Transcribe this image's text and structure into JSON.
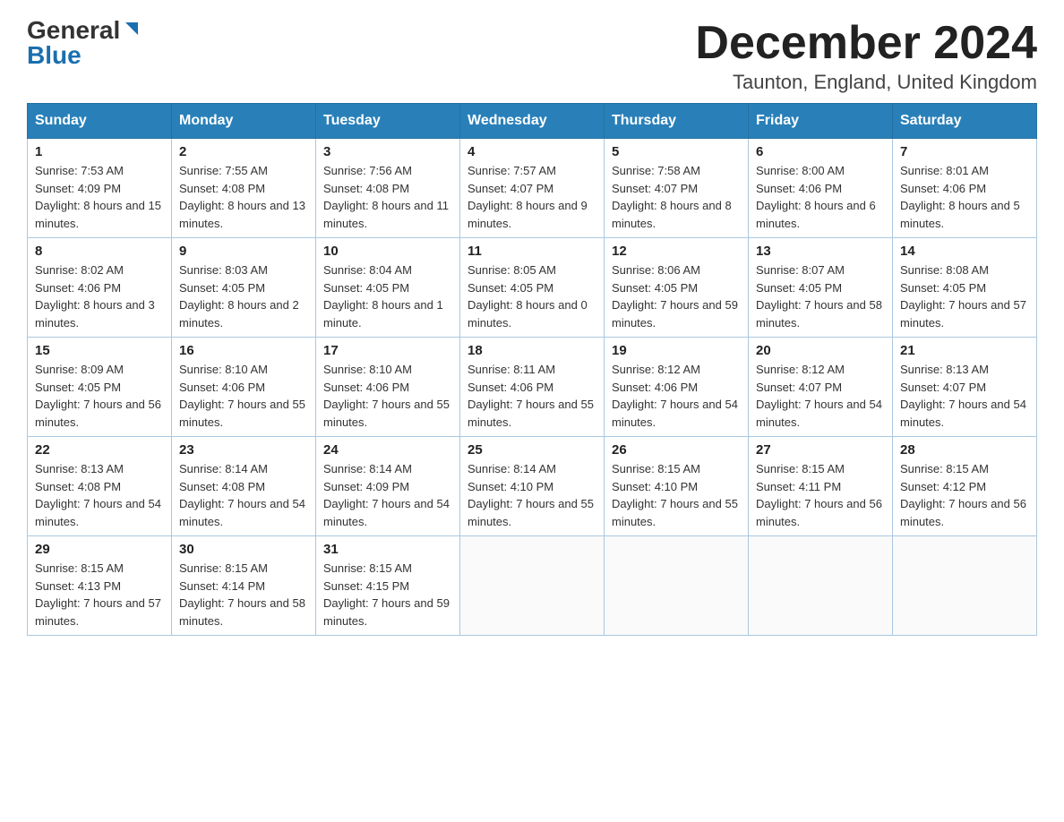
{
  "header": {
    "logo_general": "General",
    "logo_blue": "Blue",
    "month_title": "December 2024",
    "location": "Taunton, England, United Kingdom"
  },
  "columns": [
    "Sunday",
    "Monday",
    "Tuesday",
    "Wednesday",
    "Thursday",
    "Friday",
    "Saturday"
  ],
  "weeks": [
    [
      {
        "day": "1",
        "sunrise": "7:53 AM",
        "sunset": "4:09 PM",
        "daylight": "8 hours and 15 minutes."
      },
      {
        "day": "2",
        "sunrise": "7:55 AM",
        "sunset": "4:08 PM",
        "daylight": "8 hours and 13 minutes."
      },
      {
        "day": "3",
        "sunrise": "7:56 AM",
        "sunset": "4:08 PM",
        "daylight": "8 hours and 11 minutes."
      },
      {
        "day": "4",
        "sunrise": "7:57 AM",
        "sunset": "4:07 PM",
        "daylight": "8 hours and 9 minutes."
      },
      {
        "day": "5",
        "sunrise": "7:58 AM",
        "sunset": "4:07 PM",
        "daylight": "8 hours and 8 minutes."
      },
      {
        "day": "6",
        "sunrise": "8:00 AM",
        "sunset": "4:06 PM",
        "daylight": "8 hours and 6 minutes."
      },
      {
        "day": "7",
        "sunrise": "8:01 AM",
        "sunset": "4:06 PM",
        "daylight": "8 hours and 5 minutes."
      }
    ],
    [
      {
        "day": "8",
        "sunrise": "8:02 AM",
        "sunset": "4:06 PM",
        "daylight": "8 hours and 3 minutes."
      },
      {
        "day": "9",
        "sunrise": "8:03 AM",
        "sunset": "4:05 PM",
        "daylight": "8 hours and 2 minutes."
      },
      {
        "day": "10",
        "sunrise": "8:04 AM",
        "sunset": "4:05 PM",
        "daylight": "8 hours and 1 minute."
      },
      {
        "day": "11",
        "sunrise": "8:05 AM",
        "sunset": "4:05 PM",
        "daylight": "8 hours and 0 minutes."
      },
      {
        "day": "12",
        "sunrise": "8:06 AM",
        "sunset": "4:05 PM",
        "daylight": "7 hours and 59 minutes."
      },
      {
        "day": "13",
        "sunrise": "8:07 AM",
        "sunset": "4:05 PM",
        "daylight": "7 hours and 58 minutes."
      },
      {
        "day": "14",
        "sunrise": "8:08 AM",
        "sunset": "4:05 PM",
        "daylight": "7 hours and 57 minutes."
      }
    ],
    [
      {
        "day": "15",
        "sunrise": "8:09 AM",
        "sunset": "4:05 PM",
        "daylight": "7 hours and 56 minutes."
      },
      {
        "day": "16",
        "sunrise": "8:10 AM",
        "sunset": "4:06 PM",
        "daylight": "7 hours and 55 minutes."
      },
      {
        "day": "17",
        "sunrise": "8:10 AM",
        "sunset": "4:06 PM",
        "daylight": "7 hours and 55 minutes."
      },
      {
        "day": "18",
        "sunrise": "8:11 AM",
        "sunset": "4:06 PM",
        "daylight": "7 hours and 55 minutes."
      },
      {
        "day": "19",
        "sunrise": "8:12 AM",
        "sunset": "4:06 PM",
        "daylight": "7 hours and 54 minutes."
      },
      {
        "day": "20",
        "sunrise": "8:12 AM",
        "sunset": "4:07 PM",
        "daylight": "7 hours and 54 minutes."
      },
      {
        "day": "21",
        "sunrise": "8:13 AM",
        "sunset": "4:07 PM",
        "daylight": "7 hours and 54 minutes."
      }
    ],
    [
      {
        "day": "22",
        "sunrise": "8:13 AM",
        "sunset": "4:08 PM",
        "daylight": "7 hours and 54 minutes."
      },
      {
        "day": "23",
        "sunrise": "8:14 AM",
        "sunset": "4:08 PM",
        "daylight": "7 hours and 54 minutes."
      },
      {
        "day": "24",
        "sunrise": "8:14 AM",
        "sunset": "4:09 PM",
        "daylight": "7 hours and 54 minutes."
      },
      {
        "day": "25",
        "sunrise": "8:14 AM",
        "sunset": "4:10 PM",
        "daylight": "7 hours and 55 minutes."
      },
      {
        "day": "26",
        "sunrise": "8:15 AM",
        "sunset": "4:10 PM",
        "daylight": "7 hours and 55 minutes."
      },
      {
        "day": "27",
        "sunrise": "8:15 AM",
        "sunset": "4:11 PM",
        "daylight": "7 hours and 56 minutes."
      },
      {
        "day": "28",
        "sunrise": "8:15 AM",
        "sunset": "4:12 PM",
        "daylight": "7 hours and 56 minutes."
      }
    ],
    [
      {
        "day": "29",
        "sunrise": "8:15 AM",
        "sunset": "4:13 PM",
        "daylight": "7 hours and 57 minutes."
      },
      {
        "day": "30",
        "sunrise": "8:15 AM",
        "sunset": "4:14 PM",
        "daylight": "7 hours and 58 minutes."
      },
      {
        "day": "31",
        "sunrise": "8:15 AM",
        "sunset": "4:15 PM",
        "daylight": "7 hours and 59 minutes."
      },
      null,
      null,
      null,
      null
    ]
  ],
  "labels": {
    "sunrise": "Sunrise:",
    "sunset": "Sunset:",
    "daylight": "Daylight:"
  }
}
